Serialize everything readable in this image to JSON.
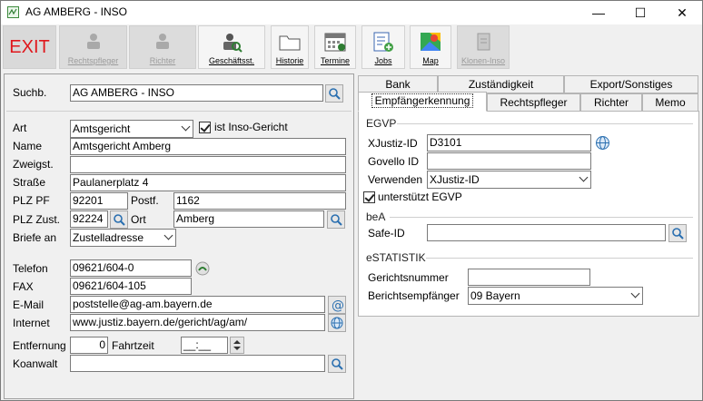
{
  "window": {
    "title": "AG AMBERG - INSO",
    "minimize": "—",
    "maximize": "☐",
    "close": "✕"
  },
  "toolbar": {
    "exit": "EXIT",
    "rechtspfleger": "Rechtspfleger",
    "richter": "Richter",
    "geschaeftsst": "Geschäftsst.",
    "historie": "Historie",
    "termine": "Termine",
    "jobs": "Jobs",
    "map": "Map",
    "klonen": "Klonen-Inso"
  },
  "left": {
    "suchb_label": "Suchb.",
    "suchb_value": "AG AMBERG - INSO",
    "art_label": "Art",
    "art_value": "Amtsgericht",
    "inso_label": "ist Inso-Gericht",
    "name_label": "Name",
    "name_value": "Amtsgericht Amberg",
    "zweigst_label": "Zweigst.",
    "zweigst_value": "",
    "strasse_label": "Straße",
    "strasse_value": "Paulanerplatz 4",
    "plzpf_label": "PLZ PF",
    "plzpf_value": "92201",
    "postf_label": "Postf.",
    "postf_value": "1162",
    "plzzust_label": "PLZ Zust.",
    "plzzust_value": "92224",
    "ort_label": "Ort",
    "ort_value": "Amberg",
    "briefe_label": "Briefe an",
    "briefe_value": "Zustelladresse",
    "telefon_label": "Telefon",
    "telefon_value": "09621/604-0",
    "fax_label": "FAX",
    "fax_value": "09621/604-105",
    "email_label": "E-Mail",
    "email_value": "poststelle@ag-am.bayern.de",
    "internet_label": "Internet",
    "internet_value": "www.justiz.bayern.de/gericht/ag/am/",
    "entfernung_label": "Entfernung",
    "entfernung_value": "0",
    "fahrzeit_label": "Fahrtzeit",
    "fahrzeit_value": "__:__",
    "koanwalt_label": "Koanwalt",
    "koanwalt_value": ""
  },
  "tabs": {
    "row1": [
      "Bank",
      "Zuständigkeit",
      "Export/Sonstiges"
    ],
    "row2": [
      "Empfängerkennung",
      "Rechtspfleger",
      "Richter",
      "Memo"
    ]
  },
  "right": {
    "egvp_group": "EGVP",
    "xjustiz_label": "XJustiz-ID",
    "xjustiz_value": "D3101",
    "govello_label": "Govello ID",
    "govello_value": "",
    "verwenden_label": "Verwenden",
    "verwenden_value": "XJustiz-ID",
    "egvp_check_label": "unterstützt EGVP",
    "bea_group": "beA",
    "safeid_label": "Safe-ID",
    "safeid_value": "",
    "estat_group": "eSTATISTIK",
    "gerichtsnr_label": "Gerichtsnummer",
    "gerichtsnr_value": "",
    "berichts_label": "Berichtsempfänger",
    "berichts_value": "09 Bayern"
  }
}
